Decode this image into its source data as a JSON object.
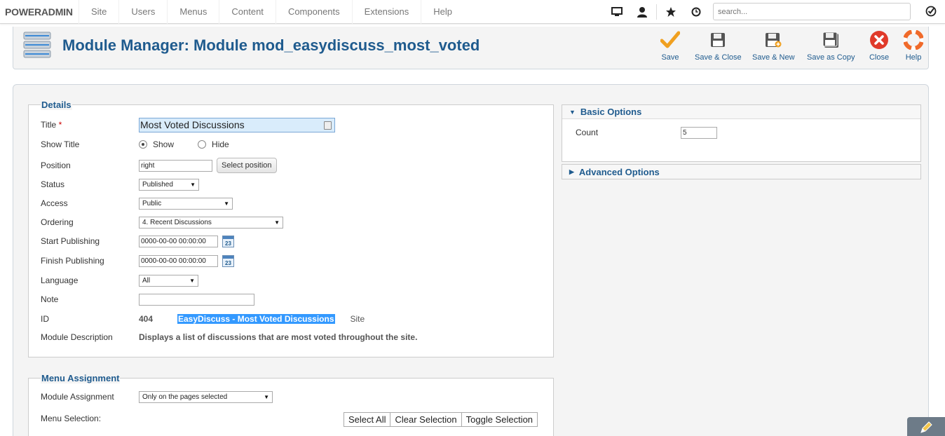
{
  "brand": {
    "part1": "POWER",
    "part2": "ADMIN"
  },
  "nav": [
    "Site",
    "Users",
    "Menus",
    "Content",
    "Components",
    "Extensions",
    "Help"
  ],
  "top_icons": [
    "monitor-icon",
    "user-icon",
    "star-icon",
    "clock-icon"
  ],
  "search": {
    "placeholder": "search..."
  },
  "page_title": "Module Manager: Module mod_easydiscuss_most_voted",
  "toolbar": {
    "save": "Save",
    "save_close": "Save & Close",
    "save_new": "Save & New",
    "save_copy": "Save as Copy",
    "close": "Close",
    "help": "Help"
  },
  "details": {
    "legend": "Details",
    "title_label": "Title",
    "required_mark": "*",
    "title_value": "Most Voted Discussions",
    "show_title_label": "Show Title",
    "show_label": "Show",
    "hide_label": "Hide",
    "show_title_selected": "Show",
    "position_label": "Position",
    "position_value": "right",
    "select_position": "Select position",
    "status_label": "Status",
    "status_value": "Published",
    "access_label": "Access",
    "access_value": "Public",
    "ordering_label": "Ordering",
    "ordering_value": "4. Recent Discussions",
    "start_label": "Start Publishing",
    "start_value": "0000-00-00 00:00:00",
    "finish_label": "Finish Publishing",
    "finish_value": "0000-00-00 00:00:00",
    "calendar_day": "23",
    "language_label": "Language",
    "language_value": "All",
    "note_label": "Note",
    "note_value": "",
    "id_label": "ID",
    "id_value": "404",
    "id_name": "EasyDiscuss - Most Voted Discussions",
    "id_site": "Site",
    "desc_label": "Module Description",
    "desc_value": "Displays a list of discussions that are most voted throughout the site."
  },
  "menu": {
    "legend": "Menu Assignment",
    "assignment_label": "Module Assignment",
    "assignment_value": "Only on the pages selected",
    "selection_label": "Menu Selection:",
    "select_all": "Select All",
    "clear_selection": "Clear Selection",
    "toggle_selection": "Toggle Selection"
  },
  "options": {
    "basic_title": "Basic Options",
    "count_label": "Count",
    "count_value": "5",
    "advanced_title": "Advanced Options"
  },
  "colors": {
    "accent": "#1f5b8e",
    "save": "#f0a020",
    "close": "#e03a2a",
    "help": "#f06a2a"
  }
}
